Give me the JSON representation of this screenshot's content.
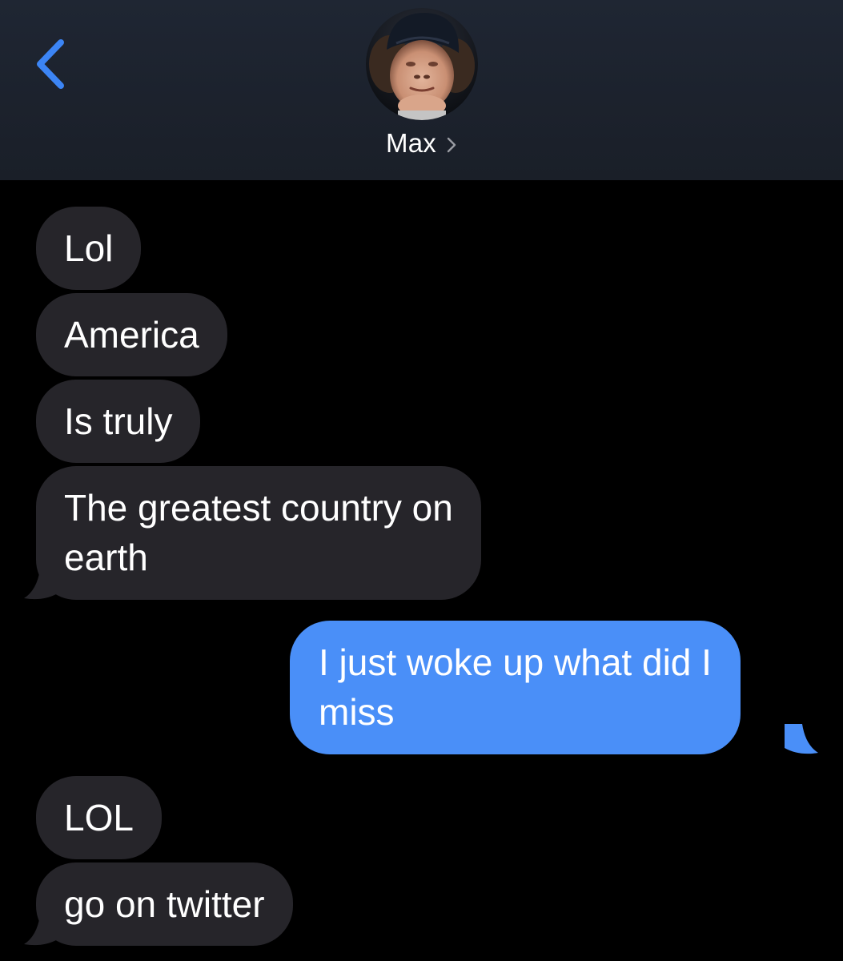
{
  "header": {
    "back_icon": "chevron-left-icon",
    "avatar_icon": "contact-photo",
    "contact_name": "Max",
    "contact_chevron_icon": "chevron-right-icon"
  },
  "messages": [
    {
      "direction": "incoming",
      "lines": [
        "Lol"
      ]
    },
    {
      "direction": "incoming",
      "lines": [
        "America"
      ]
    },
    {
      "direction": "incoming",
      "lines": [
        "Is truly"
      ]
    },
    {
      "direction": "incoming",
      "lines": [
        "The greatest country on",
        "earth"
      ]
    },
    {
      "direction": "outgoing",
      "lines": [
        "I just woke up what did I",
        "miss"
      ]
    },
    {
      "direction": "incoming",
      "lines": [
        "LOL"
      ]
    },
    {
      "direction": "incoming",
      "lines": [
        "go on twitter"
      ]
    }
  ],
  "colors": {
    "background": "#000000",
    "header_background": "#1d232e",
    "incoming_bubble": "#26252a",
    "outgoing_bubble": "#4a8ff8",
    "accent": "#3c85f5",
    "text": "#ffffff"
  }
}
